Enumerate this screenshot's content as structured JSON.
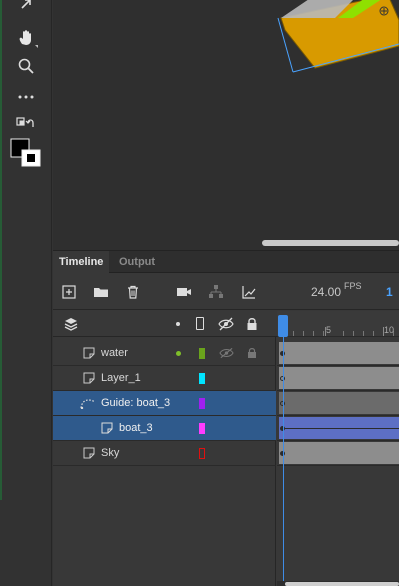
{
  "tabs": [
    {
      "label": "Timeline",
      "active": true
    },
    {
      "label": "Output",
      "active": false
    }
  ],
  "tools": [
    {
      "name": "subselect-icon"
    },
    {
      "name": "hand-icon"
    },
    {
      "name": "zoom-icon"
    },
    {
      "name": "more-tools-icon"
    },
    {
      "name": "swap-colors-icon"
    },
    {
      "name": "stroke-fill-icon"
    }
  ],
  "timeline_toolbar": {
    "fps_value": "24.00",
    "fps_unit": "FPS",
    "current_frame": "1"
  },
  "ruler": {
    "labels": [
      "5",
      "10"
    ]
  },
  "layers": [
    {
      "name": "water",
      "type": "normal",
      "color": "#6aa31c",
      "selected": false
    },
    {
      "name": "Layer_1",
      "type": "normal",
      "color": "#00e5ff",
      "selected": false
    },
    {
      "name": "Guide: boat_3",
      "type": "guide",
      "color": "#a020f0",
      "selected": true
    },
    {
      "name": "boat_3",
      "type": "normal",
      "color": "#ff3cff",
      "selected": true
    },
    {
      "name": "Sky",
      "type": "normal",
      "color": "#e01010",
      "selected": false
    }
  ],
  "colors": {
    "accent": "#3f8ce6",
    "selected_row": "#2f5a8c",
    "boat_fill": "#d89a00",
    "boat_green": "#8fe000"
  }
}
